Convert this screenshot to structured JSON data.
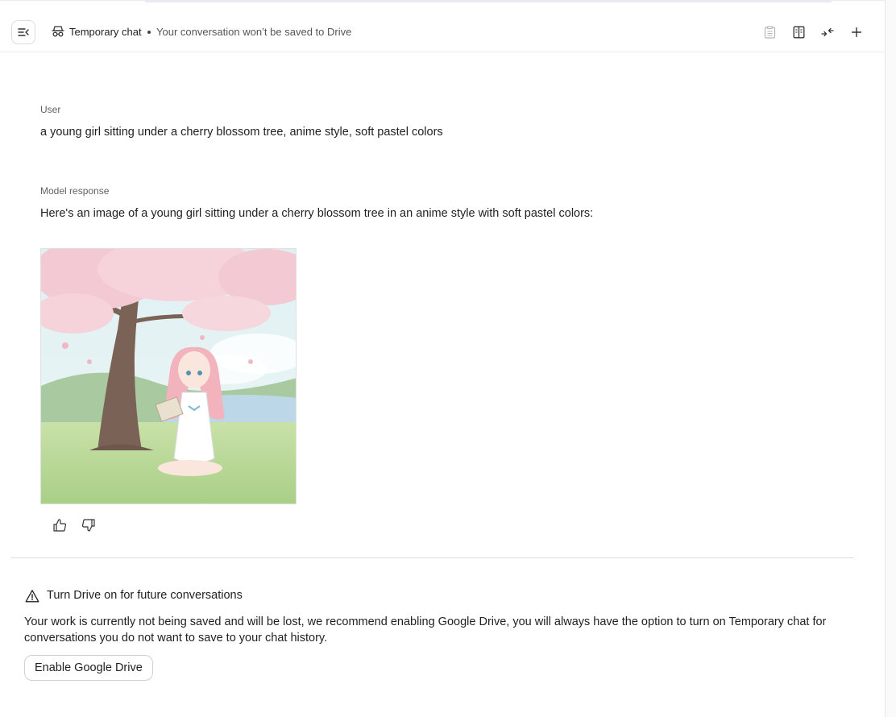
{
  "header": {
    "title": "Temporary chat",
    "subtitle": "Your conversation won’t be saved to Drive",
    "icons": [
      "menu-collapse-icon",
      "temporary-chat-icon",
      "clipboard-icon",
      "compare-icon",
      "collapse-icon",
      "plus-icon"
    ]
  },
  "conversation": {
    "user_label": "User",
    "user_message": "a young girl sitting under a cherry blossom tree, anime style, soft pastel colors",
    "model_label": "Model response",
    "model_message": "Here's an image of a young girl sitting under a cherry blossom tree in an anime style with soft pastel colors:",
    "feedback_icons": [
      "thumbs-up-icon",
      "thumbs-down-icon"
    ]
  },
  "notice": {
    "title": "Turn Drive on for future conversations",
    "body": "Your work is currently not being saved and will be lost, we recommend enabling Google Drive, you will always have the option to turn on Temporary chat for conversations you do not want to save to your chat history.",
    "button_label": "Enable Google Drive"
  },
  "colors": {
    "background": "#ffffff",
    "text": "#1f1f1f",
    "muted": "#5f6368",
    "border": "#d9d9d9"
  }
}
